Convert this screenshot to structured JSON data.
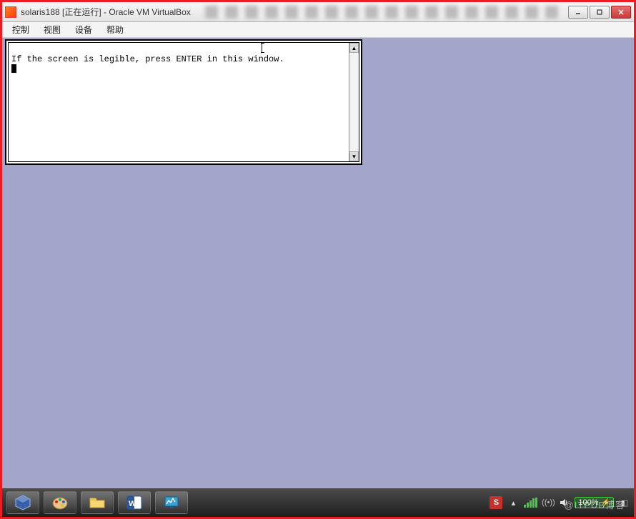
{
  "window": {
    "title": "solaris188 [正在运行] - Oracle VM VirtualBox"
  },
  "menu": {
    "items": [
      "控制",
      "视图",
      "设备",
      "帮助"
    ]
  },
  "terminal": {
    "line1": "If the screen is legible, press ENTER in this window."
  },
  "tray": {
    "ime_label": "S",
    "battery_pct": "100%",
    "watermark": "@ITPUB博客"
  },
  "task_icons": [
    "virtualbox",
    "paint",
    "explorer",
    "word",
    "task-manager"
  ]
}
